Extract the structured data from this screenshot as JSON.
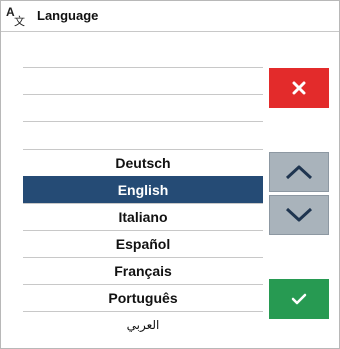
{
  "header": {
    "icon": "translate-icon",
    "icon_glyph_a": "A",
    "icon_glyph_z": "文",
    "title": "Language"
  },
  "languages": [
    {
      "label": "Deutsch",
      "selected": false
    },
    {
      "label": "English",
      "selected": true
    },
    {
      "label": "Italiano",
      "selected": false
    },
    {
      "label": "Español",
      "selected": false
    },
    {
      "label": "Français",
      "selected": false
    },
    {
      "label": "Português",
      "selected": false
    },
    {
      "label": "العربي",
      "selected": false
    }
  ],
  "buttons": {
    "cancel_icon": "close-icon",
    "up_icon": "chevron-up-icon",
    "down_icon": "chevron-down-icon",
    "confirm_icon": "checkmark-icon"
  },
  "colors": {
    "selected": "#254b75",
    "cancel": "#e32b2b",
    "confirm": "#279a52",
    "scroll": "#a9b3bb"
  }
}
